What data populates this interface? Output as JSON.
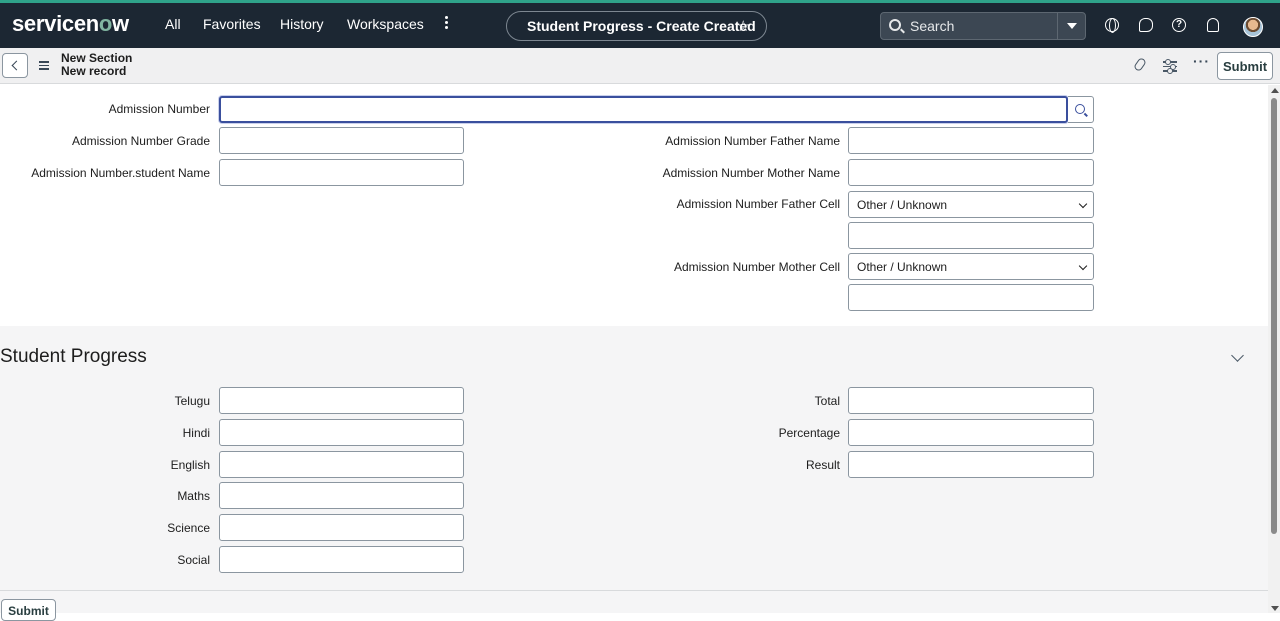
{
  "nav": {
    "logo_pre": "servicen",
    "logo_o": "o",
    "logo_post": "w",
    "links": [
      "All",
      "Favorites",
      "History",
      "Workspaces"
    ],
    "record_title": "Student Progress - Create Created",
    "search_placeholder": "Search"
  },
  "subheader": {
    "line1": "New Section",
    "line2": "New record",
    "submit_label": "Submit"
  },
  "form": {
    "admission_number": {
      "label": "Admission Number",
      "value": ""
    },
    "grade": {
      "label": "Admission Number Grade",
      "value": ""
    },
    "student_name": {
      "label": "Admission Number.student Name",
      "value": ""
    },
    "father_name": {
      "label": "Admission Number Father Name",
      "value": ""
    },
    "mother_name": {
      "label": "Admission Number Mother Name",
      "value": ""
    },
    "father_cell": {
      "label": "Admission Number Father Cell",
      "selected": "Other / Unknown",
      "value": ""
    },
    "mother_cell": {
      "label": "Admission Number Mother Cell",
      "selected": "Other / Unknown",
      "value": ""
    }
  },
  "progress": {
    "title": "Student Progress",
    "left_fields": [
      "Telugu",
      "Hindi",
      "English",
      "Maths",
      "Science",
      "Social"
    ],
    "right_fields": [
      "Total",
      "Percentage",
      "Result"
    ],
    "submit_label": "Submit"
  },
  "colors": {
    "nav_bg": "#1c2733",
    "accent": "#3a4f9d",
    "brand_green": "#81b5a1"
  }
}
